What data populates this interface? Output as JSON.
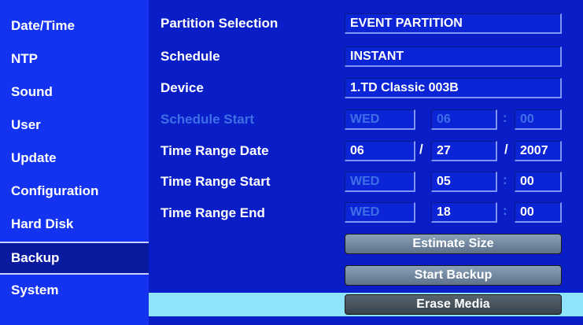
{
  "sidebar": {
    "items": [
      {
        "label": "Date/Time"
      },
      {
        "label": "NTP"
      },
      {
        "label": "Sound"
      },
      {
        "label": "User"
      },
      {
        "label": "Update"
      },
      {
        "label": "Configuration"
      },
      {
        "label": "Hard Disk"
      },
      {
        "label": "Backup"
      },
      {
        "label": "System"
      }
    ],
    "selected": "Backup"
  },
  "form": {
    "partition_selection": {
      "label": "Partition Selection",
      "value": "EVENT PARTITION"
    },
    "schedule": {
      "label": "Schedule",
      "value": "INSTANT"
    },
    "device": {
      "label": "Device",
      "value": "1.TD Classic 003B"
    },
    "schedule_start": {
      "label": "Schedule Start",
      "day": "WED",
      "hour": "06",
      "sep": ":",
      "minute": "00",
      "disabled": true
    },
    "time_range_date": {
      "label": "Time Range Date",
      "month": "06",
      "sep1": "/",
      "day": "27",
      "sep2": "/",
      "year": "2007"
    },
    "time_range_start": {
      "label": "Time Range Start",
      "day": "WED",
      "hour": "05",
      "sep": ":",
      "minute": "00"
    },
    "time_range_end": {
      "label": "Time Range End",
      "day": "WED",
      "hour": "18",
      "sep": ":",
      "minute": "00"
    }
  },
  "buttons": {
    "estimate_size": "Estimate Size",
    "start_backup": "Start Backup",
    "erase_media": "Erase Media"
  },
  "colors": {
    "background": "#0a1ec8",
    "sidebar": "#1433f0",
    "selected_item": "#0a1a9e",
    "field": "#0b25d6",
    "disabled_text": "#3f6fe6",
    "highlight_band": "#8fe3fb"
  }
}
